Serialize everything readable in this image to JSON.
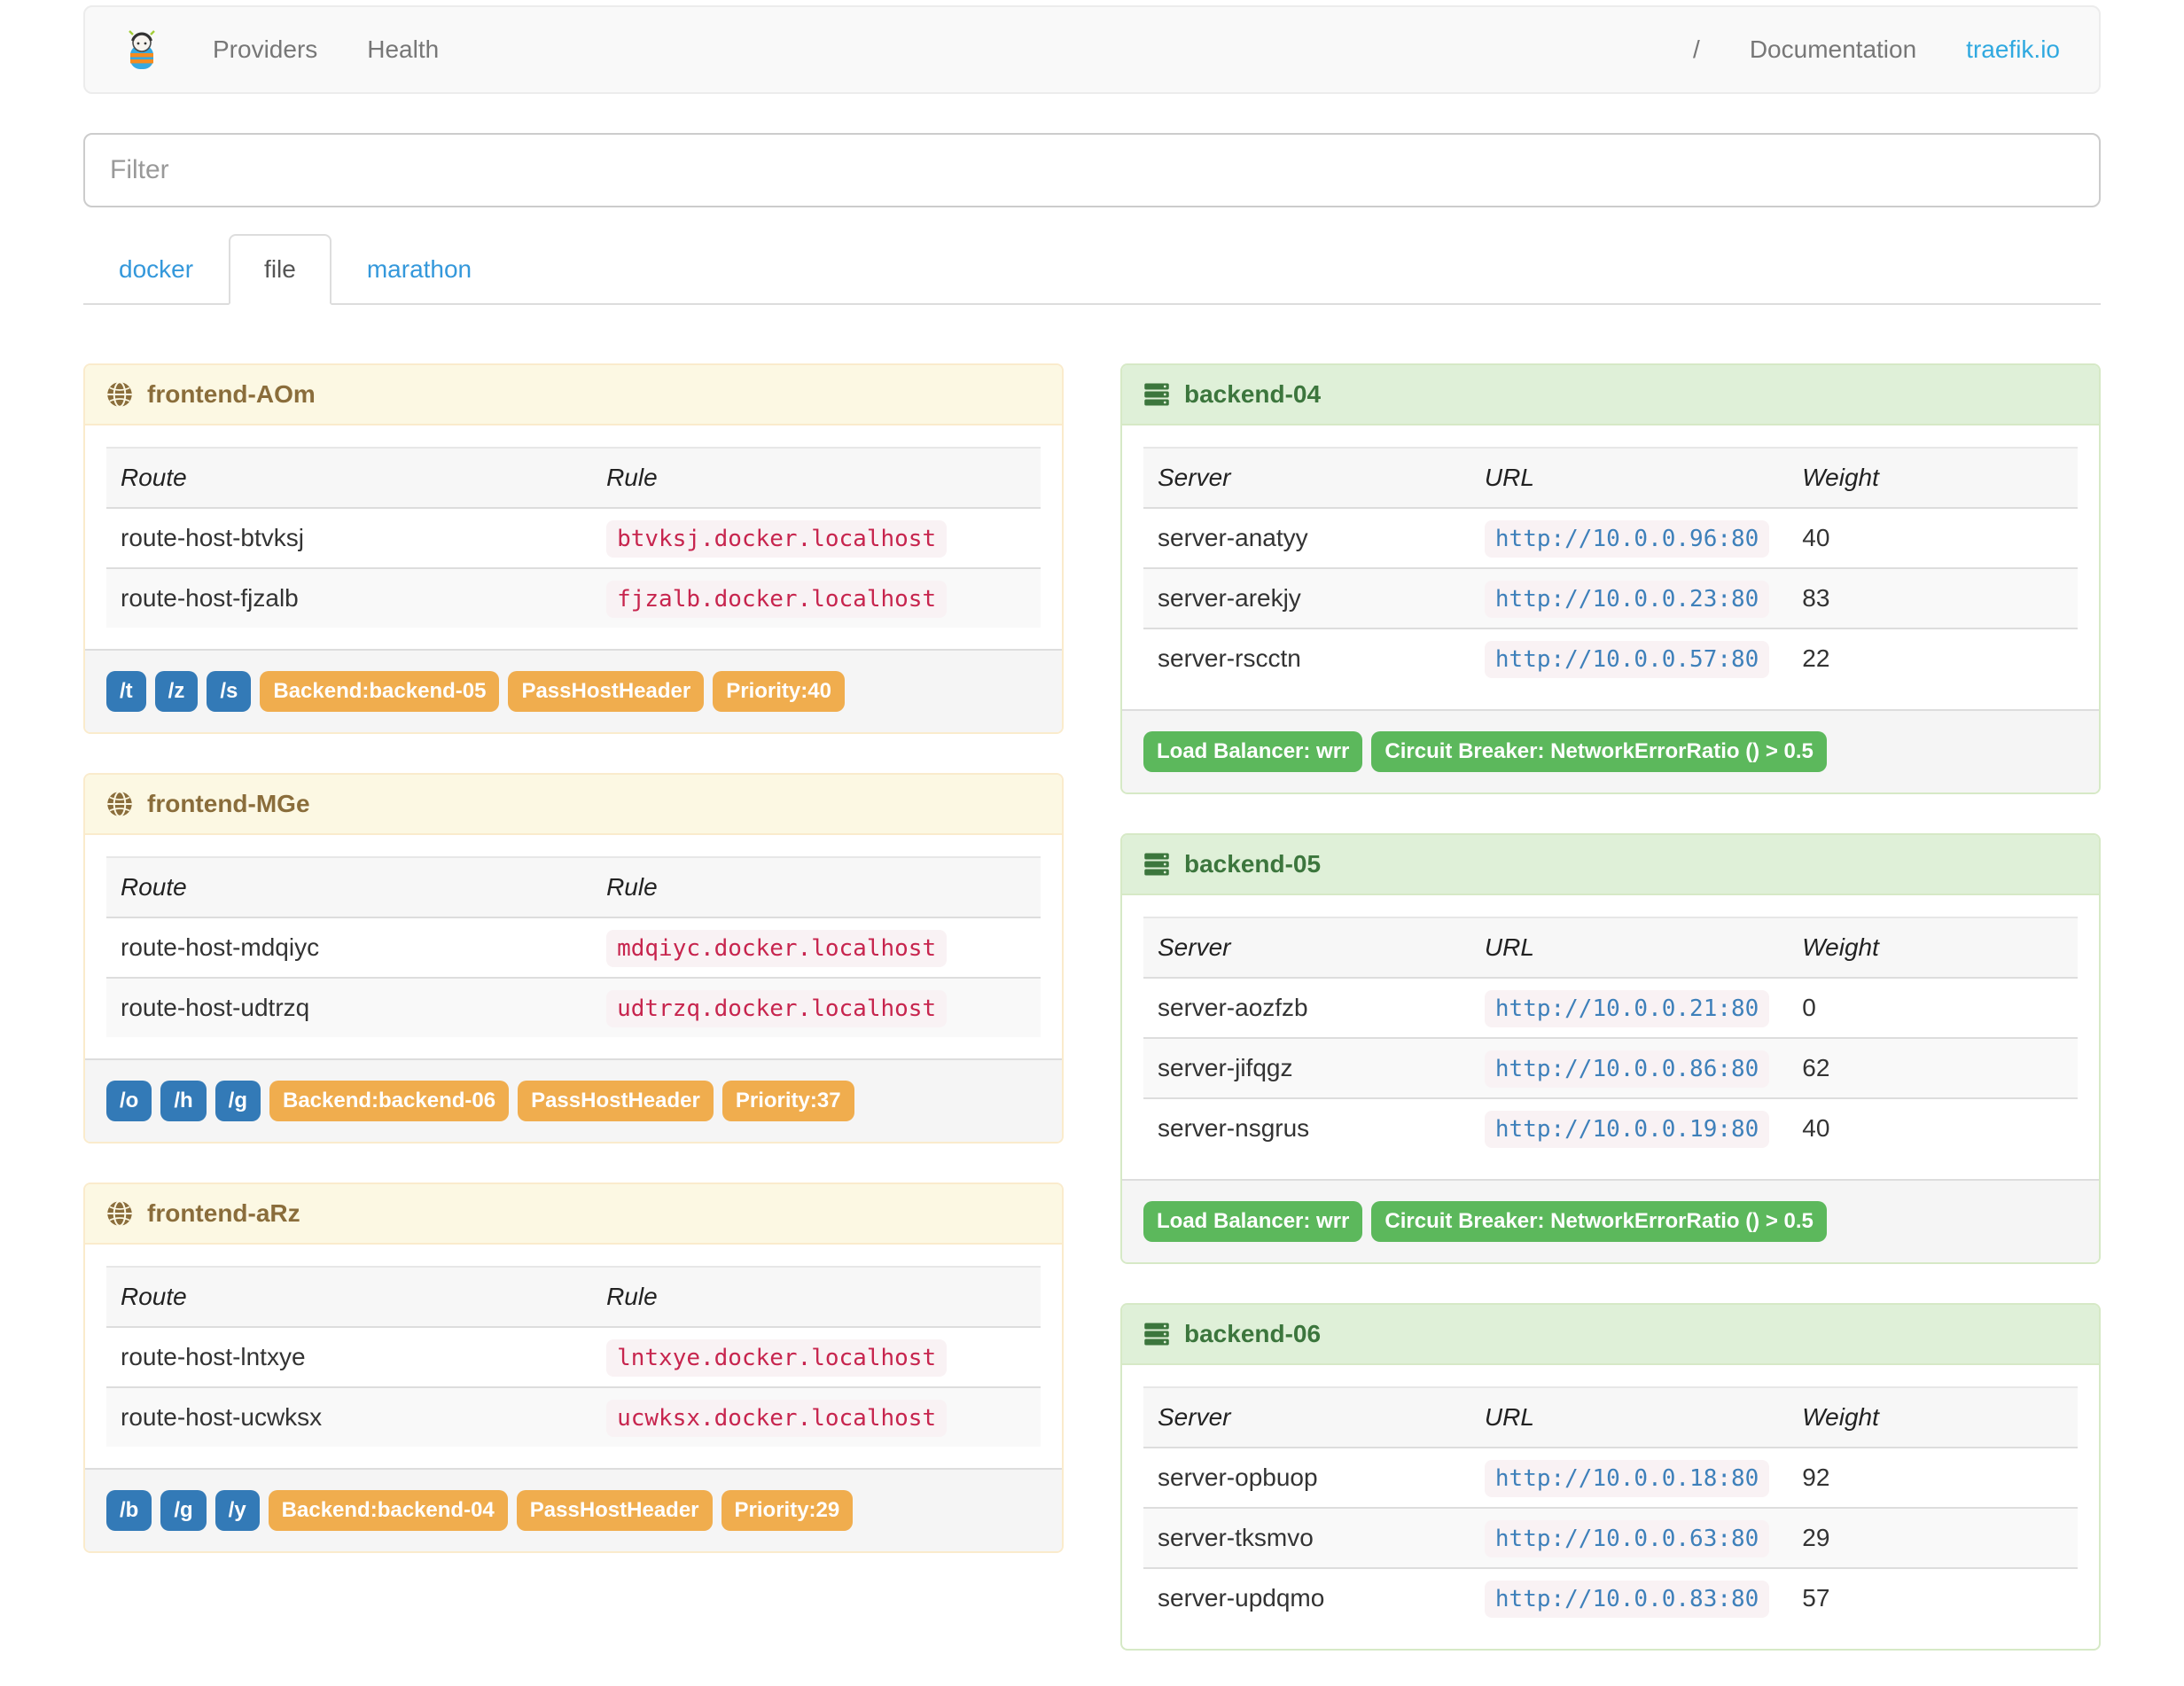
{
  "navbar": {
    "brand_icon": "traefik-logo",
    "links": [
      "Providers",
      "Health"
    ],
    "right_links": [
      "/",
      "Documentation",
      "traefik.io"
    ]
  },
  "filter": {
    "placeholder": "Filter"
  },
  "tabs": [
    {
      "label": "docker",
      "active": false
    },
    {
      "label": "file",
      "active": true
    },
    {
      "label": "marathon",
      "active": false
    }
  ],
  "frontends": [
    {
      "title": "frontend-AOm",
      "columns": [
        "Route",
        "Rule"
      ],
      "routes": [
        {
          "route": "route-host-btvksj",
          "rule": "btvksj.docker.localhost"
        },
        {
          "route": "route-host-fjzalb",
          "rule": "fjzalb.docker.localhost"
        }
      ],
      "entry_badges": [
        "/t",
        "/z",
        "/s"
      ],
      "prop_badges": [
        "Backend:backend-05",
        "PassHostHeader",
        "Priority:40"
      ]
    },
    {
      "title": "frontend-MGe",
      "columns": [
        "Route",
        "Rule"
      ],
      "routes": [
        {
          "route": "route-host-mdqiyc",
          "rule": "mdqiyc.docker.localhost"
        },
        {
          "route": "route-host-udtrzq",
          "rule": "udtrzq.docker.localhost"
        }
      ],
      "entry_badges": [
        "/o",
        "/h",
        "/g"
      ],
      "prop_badges": [
        "Backend:backend-06",
        "PassHostHeader",
        "Priority:37"
      ]
    },
    {
      "title": "frontend-aRz",
      "columns": [
        "Route",
        "Rule"
      ],
      "routes": [
        {
          "route": "route-host-lntxye",
          "rule": "lntxye.docker.localhost"
        },
        {
          "route": "route-host-ucwksx",
          "rule": "ucwksx.docker.localhost"
        }
      ],
      "entry_badges": [
        "/b",
        "/g",
        "/y"
      ],
      "prop_badges": [
        "Backend:backend-04",
        "PassHostHeader",
        "Priority:29"
      ]
    }
  ],
  "backends": [
    {
      "title": "backend-04",
      "columns": [
        "Server",
        "URL",
        "Weight"
      ],
      "servers": [
        {
          "name": "server-anatyy",
          "url": "http://10.0.0.96:80",
          "weight": "40"
        },
        {
          "name": "server-arekjy",
          "url": "http://10.0.0.23:80",
          "weight": "83"
        },
        {
          "name": "server-rscctn",
          "url": "http://10.0.0.57:80",
          "weight": "22"
        }
      ],
      "badges": [
        "Load Balancer: wrr",
        "Circuit Breaker: NetworkErrorRatio () > 0.5"
      ]
    },
    {
      "title": "backend-05",
      "columns": [
        "Server",
        "URL",
        "Weight"
      ],
      "servers": [
        {
          "name": "server-aozfzb",
          "url": "http://10.0.0.21:80",
          "weight": "0"
        },
        {
          "name": "server-jifqgz",
          "url": "http://10.0.0.86:80",
          "weight": "62"
        },
        {
          "name": "server-nsgrus",
          "url": "http://10.0.0.19:80",
          "weight": "40"
        }
      ],
      "badges": [
        "Load Balancer: wrr",
        "Circuit Breaker: NetworkErrorRatio () > 0.5"
      ]
    },
    {
      "title": "backend-06",
      "columns": [
        "Server",
        "URL",
        "Weight"
      ],
      "servers": [
        {
          "name": "server-opbuop",
          "url": "http://10.0.0.18:80",
          "weight": "92"
        },
        {
          "name": "server-tksmvo",
          "url": "http://10.0.0.63:80",
          "weight": "29"
        },
        {
          "name": "server-updqmo",
          "url": "http://10.0.0.83:80",
          "weight": "57"
        }
      ],
      "badges": []
    }
  ],
  "colors": {
    "route_badge": "#337ab7",
    "prop_badge": "#f0ad4e",
    "backend_badge": "#5cb85c",
    "frontend_header_bg": "#fcf8e3",
    "frontend_header_text": "#8a6d3b",
    "backend_header_bg": "#dff0d8",
    "backend_header_text": "#3c763d",
    "tab_link": "#3498db",
    "brand_link": "#30a9e0",
    "code_text": "#c7254e",
    "code_bg": "#f9f2f4",
    "url_text": "#3e80ba"
  }
}
